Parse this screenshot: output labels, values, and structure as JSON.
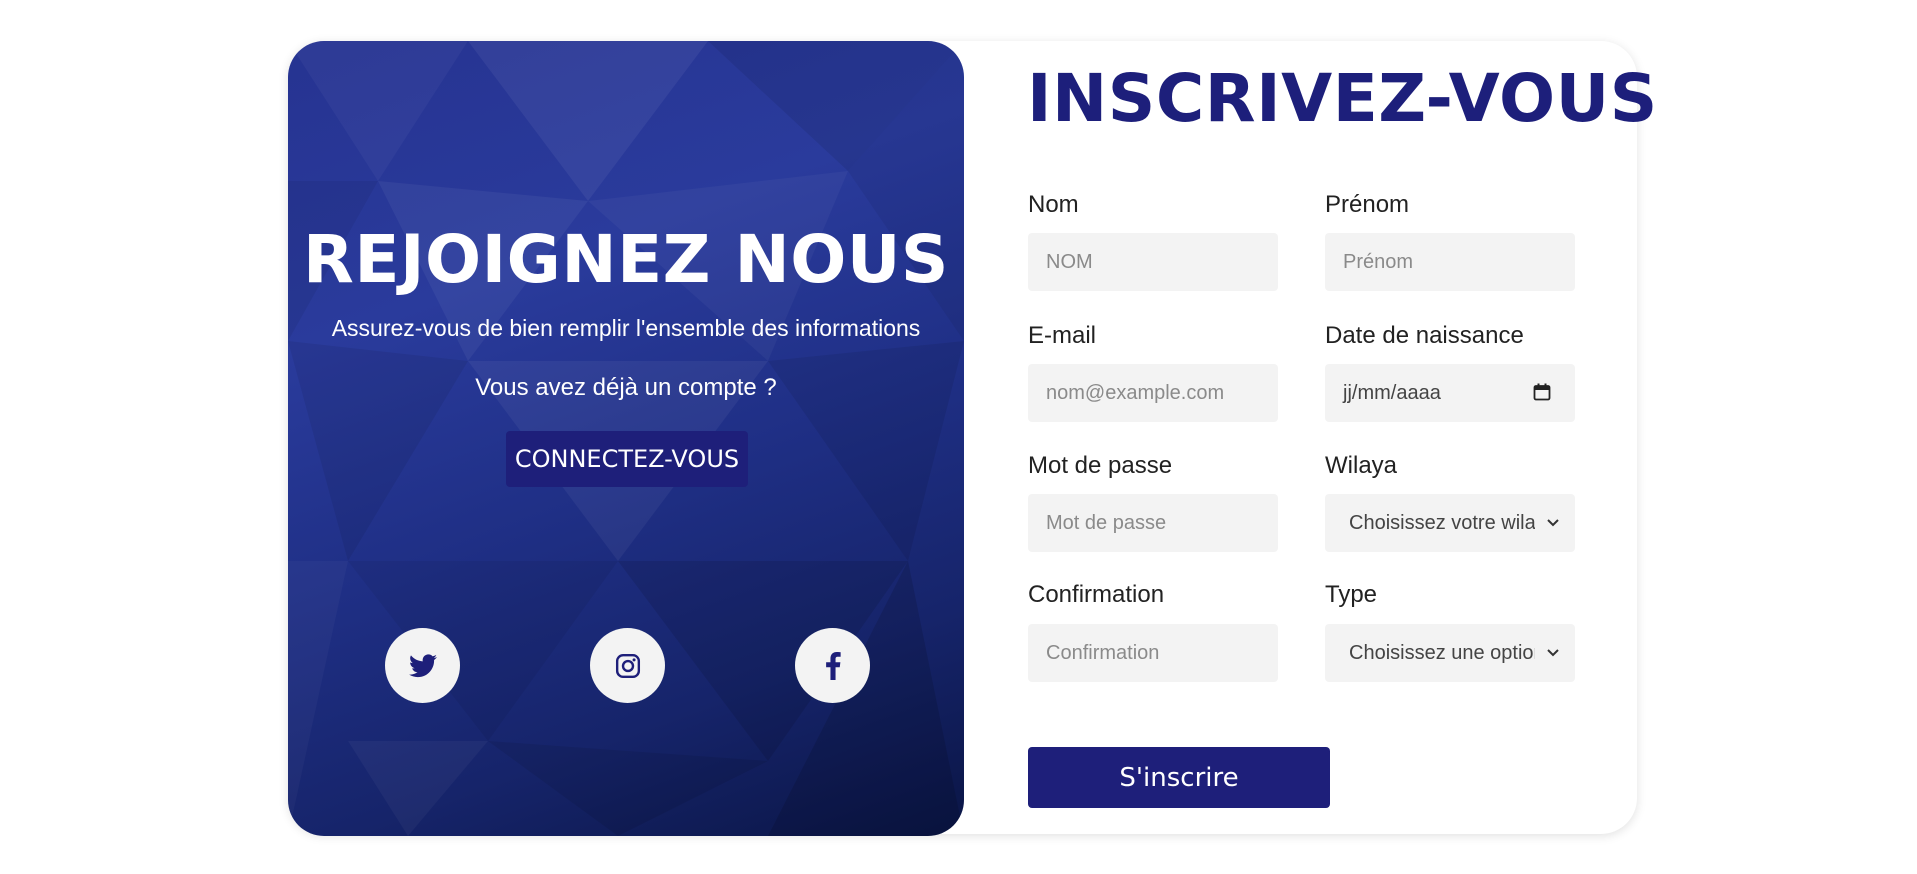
{
  "left_panel": {
    "title": "REJOIGNEZ NOUS",
    "subtitle": "Assurez-vous de bien remplir l'ensemble des informations",
    "question": "Vous avez déjà un compte ?",
    "login_button": "CONNECTEZ-VOUS",
    "social_icons": [
      "twitter-icon",
      "instagram-icon",
      "facebook-icon"
    ]
  },
  "form": {
    "title": "INSCRIVEZ-VOUS",
    "fields": {
      "nom": {
        "label": "Nom",
        "placeholder": "NOM"
      },
      "prenom": {
        "label": "Prénom",
        "placeholder": "Prénom"
      },
      "email": {
        "label": "E-mail",
        "placeholder": "nom@example.com"
      },
      "naissance": {
        "label": "Date de naissance",
        "placeholder": "jj/mm/aaaa"
      },
      "password": {
        "label": "Mot de passe",
        "placeholder": "Mot de passe"
      },
      "wilaya": {
        "label": "Wilaya",
        "selected": "Choisissez votre wilaya"
      },
      "confirmation": {
        "label": "Confirmation",
        "placeholder": "Confirmation"
      },
      "type": {
        "label": "Type",
        "selected": "Choisissez une option"
      }
    },
    "submit_label": "S'inscrire"
  },
  "colors": {
    "primary": "#1e1f7a",
    "panel_blue": "#263391",
    "field_bg": "#f3f3f3",
    "title_color": "#1d1f7b"
  }
}
